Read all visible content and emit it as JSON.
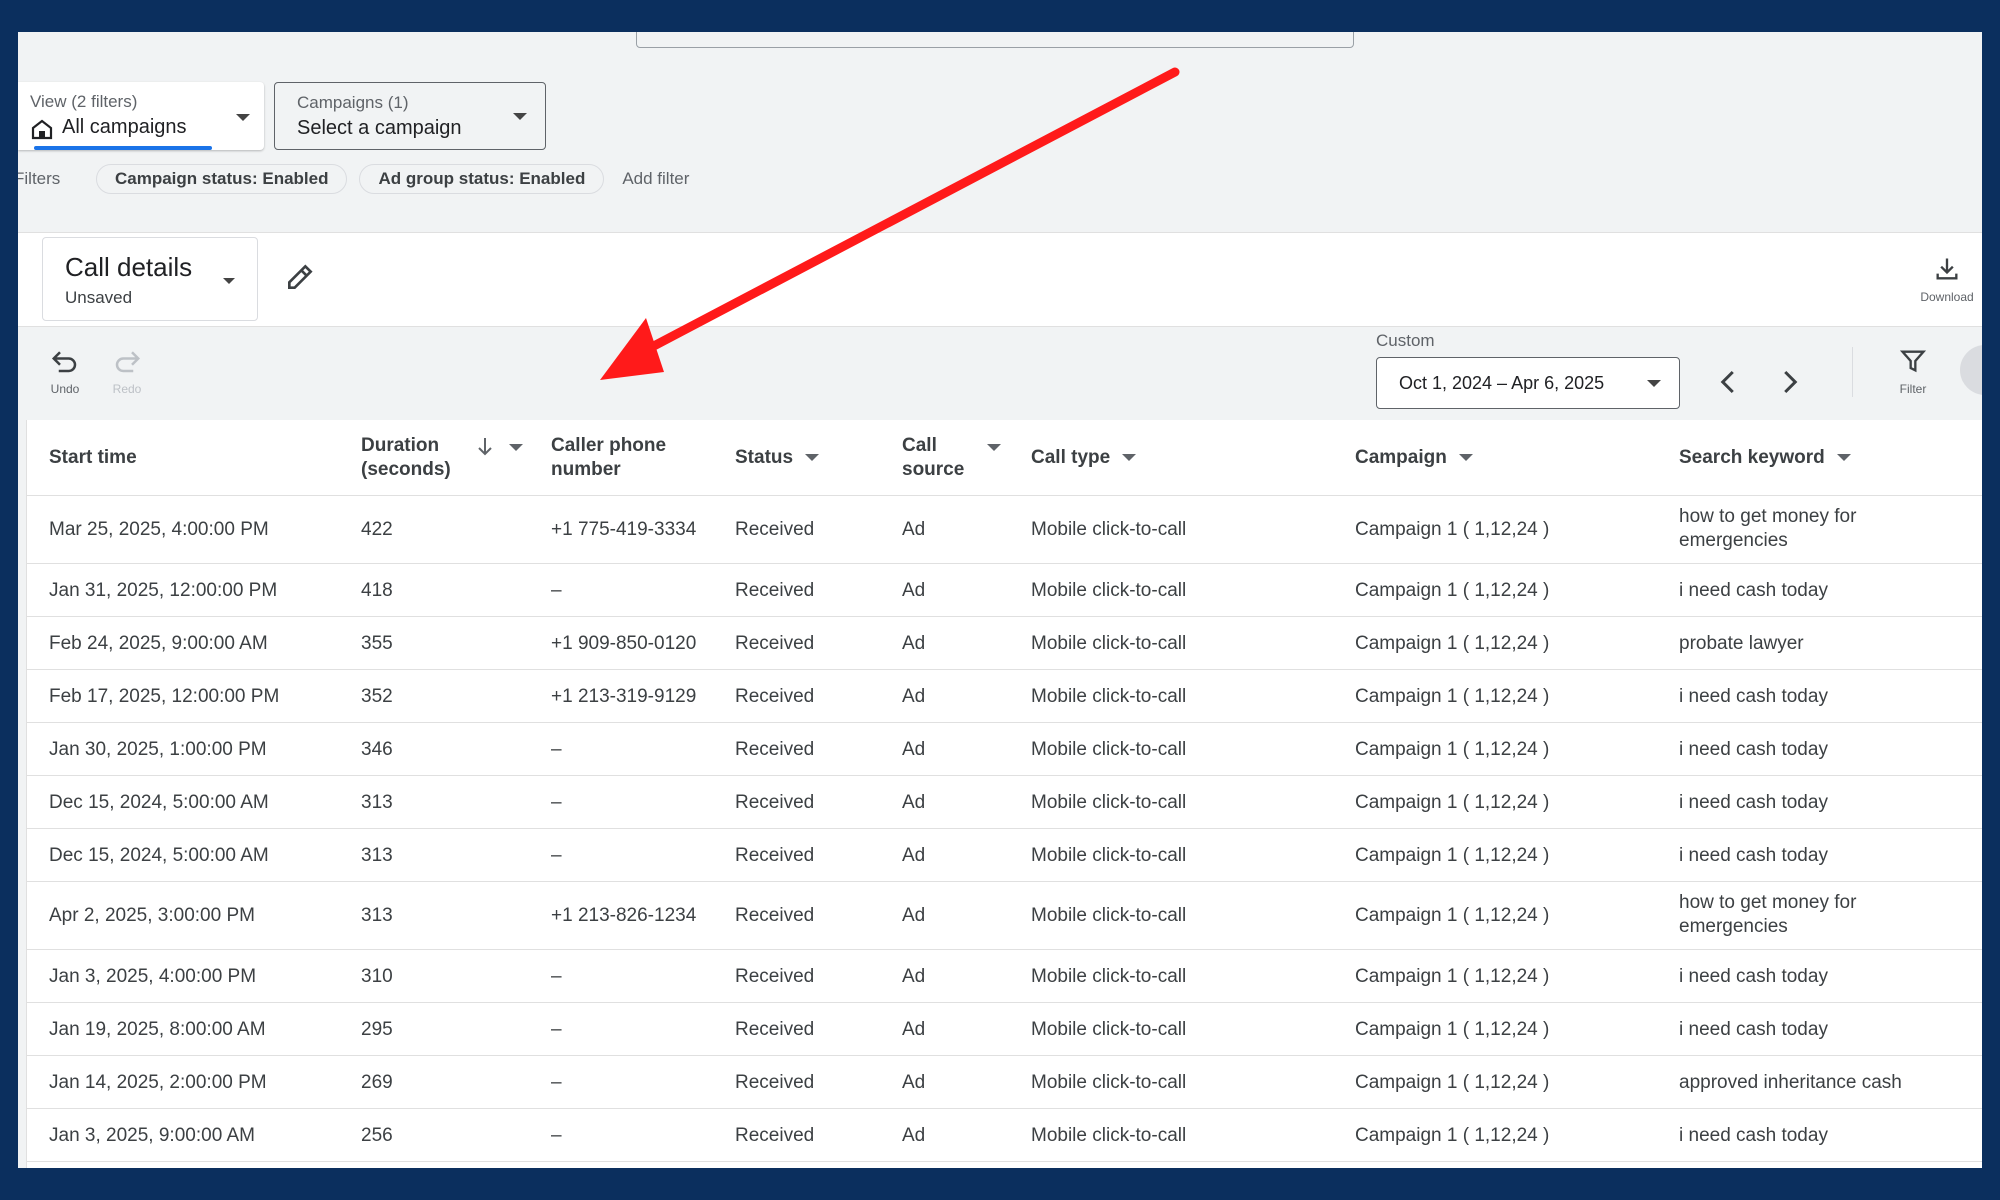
{
  "header": {
    "view": {
      "caption": "View (2 filters)",
      "value": "All campaigns"
    },
    "campaigns": {
      "caption": "Campaigns (1)",
      "value": "Select a campaign"
    },
    "filters": {
      "label": "Filters",
      "chips": [
        "Campaign status: Enabled",
        "Ad group status: Enabled"
      ],
      "add_label": "Add filter"
    }
  },
  "report": {
    "title": "Call details",
    "subtitle": "Unsaved",
    "download_label": "Download"
  },
  "toolbar": {
    "undo_label": "Undo",
    "redo_label": "Redo",
    "range_caption": "Custom",
    "date_range": "Oct 1, 2024 – Apr 6, 2025",
    "filter_label": "Filter"
  },
  "table": {
    "columns": {
      "start_time": "Start time",
      "duration_1": "Duration",
      "duration_2": "(seconds)",
      "caller_1": "Caller phone",
      "caller_2": "number",
      "status": "Status",
      "source_1": "Call",
      "source_2": "source",
      "call_type": "Call type",
      "campaign": "Campaign",
      "keyword": "Search keyword"
    },
    "rows": [
      {
        "start": "Mar 25, 2025, 4:00:00 PM",
        "duration": "422",
        "caller": "+1 775-419-3334",
        "status": "Received",
        "source": "Ad",
        "type": "Mobile click-to-call",
        "campaign": "Campaign 1 ( 1,12,24 )",
        "kw1": "how to get money for",
        "kw2": "emergencies"
      },
      {
        "start": "Jan 31, 2025, 12:00:00 PM",
        "duration": "418",
        "caller": "–",
        "status": "Received",
        "source": "Ad",
        "type": "Mobile click-to-call",
        "campaign": "Campaign 1 ( 1,12,24 )",
        "kw1": "i need cash today",
        "kw2": ""
      },
      {
        "start": "Feb 24, 2025, 9:00:00 AM",
        "duration": "355",
        "caller": "+1 909-850-0120",
        "status": "Received",
        "source": "Ad",
        "type": "Mobile click-to-call",
        "campaign": "Campaign 1 ( 1,12,24 )",
        "kw1": "probate lawyer",
        "kw2": ""
      },
      {
        "start": "Feb 17, 2025, 12:00:00 PM",
        "duration": "352",
        "caller": "+1 213-319-9129",
        "status": "Received",
        "source": "Ad",
        "type": "Mobile click-to-call",
        "campaign": "Campaign 1 ( 1,12,24 )",
        "kw1": "i need cash today",
        "kw2": ""
      },
      {
        "start": "Jan 30, 2025, 1:00:00 PM",
        "duration": "346",
        "caller": "–",
        "status": "Received",
        "source": "Ad",
        "type": "Mobile click-to-call",
        "campaign": "Campaign 1 ( 1,12,24 )",
        "kw1": "i need cash today",
        "kw2": ""
      },
      {
        "start": "Dec 15, 2024, 5:00:00 AM",
        "duration": "313",
        "caller": "–",
        "status": "Received",
        "source": "Ad",
        "type": "Mobile click-to-call",
        "campaign": "Campaign 1 ( 1,12,24 )",
        "kw1": "i need cash today",
        "kw2": ""
      },
      {
        "start": "Dec 15, 2024, 5:00:00 AM",
        "duration": "313",
        "caller": "–",
        "status": "Received",
        "source": "Ad",
        "type": "Mobile click-to-call",
        "campaign": "Campaign 1 ( 1,12,24 )",
        "kw1": "i need cash today",
        "kw2": ""
      },
      {
        "start": "Apr 2, 2025, 3:00:00 PM",
        "duration": "313",
        "caller": "+1 213-826-1234",
        "status": "Received",
        "source": "Ad",
        "type": "Mobile click-to-call",
        "campaign": "Campaign 1 ( 1,12,24 )",
        "kw1": "how to get money for",
        "kw2": "emergencies"
      },
      {
        "start": "Jan 3, 2025, 4:00:00 PM",
        "duration": "310",
        "caller": "–",
        "status": "Received",
        "source": "Ad",
        "type": "Mobile click-to-call",
        "campaign": "Campaign 1 ( 1,12,24 )",
        "kw1": "i need cash today",
        "kw2": ""
      },
      {
        "start": "Jan 19, 2025, 8:00:00 AM",
        "duration": "295",
        "caller": "–",
        "status": "Received",
        "source": "Ad",
        "type": "Mobile click-to-call",
        "campaign": "Campaign 1 ( 1,12,24 )",
        "kw1": "i need cash today",
        "kw2": ""
      },
      {
        "start": "Jan 14, 2025, 2:00:00 PM",
        "duration": "269",
        "caller": "–",
        "status": "Received",
        "source": "Ad",
        "type": "Mobile click-to-call",
        "campaign": "Campaign 1 ( 1,12,24 )",
        "kw1": "approved inheritance cash",
        "kw2": ""
      },
      {
        "start": "Jan 3, 2025, 9:00:00 AM",
        "duration": "256",
        "caller": "–",
        "status": "Received",
        "source": "Ad",
        "type": "Mobile click-to-call",
        "campaign": "Campaign 1 ( 1,12,24 )",
        "kw1": "i need cash today",
        "kw2": ""
      }
    ]
  },
  "colors": {
    "accent": "#1a73e8",
    "annotation_arrow": "#ff1a1a",
    "frame_bg": "#0b2f5e"
  },
  "icons": [
    "home-icon",
    "pencil-icon",
    "download-icon",
    "undo-icon",
    "redo-icon",
    "chevron-left-icon",
    "chevron-right-icon",
    "filter-icon",
    "sort-down-icon"
  ]
}
